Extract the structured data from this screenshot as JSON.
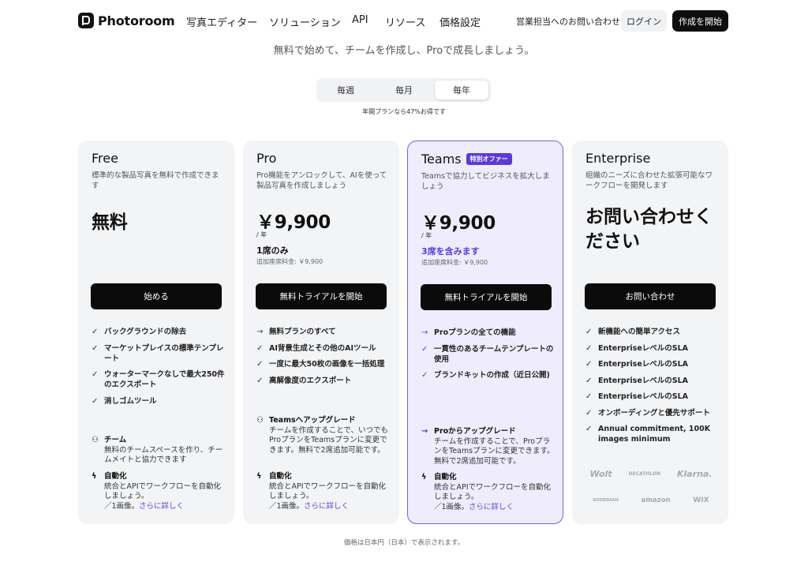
{
  "header": {
    "logo_text": "Photoroom",
    "nav": [
      "写真エディター",
      "ソリューション",
      "API",
      "リソース",
      "価格設定"
    ],
    "contact_sales": "営業担当へのお問い合わせ",
    "login": "ログイン",
    "start": "作成を開始"
  },
  "subtitle": "無料で始めて、チームを作成し、Proで成長しましょう。",
  "billing": {
    "options": [
      "毎週",
      "毎月",
      "毎年"
    ],
    "selected": "毎年",
    "note": "年間プランなら47%お得です"
  },
  "plans": [
    {
      "name": "Free",
      "desc": "標準的な製品写真を無料で作成できます",
      "price": "無料",
      "cta": "始める",
      "features": [
        "バックグラウンドの除去",
        "マーケットプレイスの標準テンプレート",
        "ウォーターマークなしで最大250件のエクスポート",
        "消しゴムツール"
      ],
      "team": {
        "title": "チーム",
        "body": "無料のチームスペースを作り、チームメイトと協力できます"
      },
      "automation": {
        "title": "自動化",
        "body": "統合とAPIでワークフローを自動化しましょう。",
        "suffix": "／1画像。",
        "link": "さらに詳しく"
      }
    },
    {
      "name": "Pro",
      "desc": "Pro機能をアンロックして、AIを使って製品写真を作成しましょう",
      "price": "￥9,900",
      "per": "/ 年",
      "seats": "1席のみ",
      "extra": "追加座席料金: ￥9,900",
      "cta": "無料トライアルを開始",
      "features": [
        "無料プランのすべて",
        "AI背景生成とその他のAIツール",
        "一度に最大50枚の画像を一括処理",
        "高解像度のエクスポート"
      ],
      "upgrade": {
        "title": "Teamsへアップグレード",
        "body": "チームを作成することで、いつでもProプランをTeamsプランに変更できます。無料で2席追加可能です。"
      },
      "automation": {
        "title": "自動化",
        "body": "統合とAPIでワークフローを自動化しましょう。",
        "suffix": "／1画像。",
        "link": "さらに詳しく"
      }
    },
    {
      "name": "Teams",
      "badge": "特別オファー",
      "desc": "Teamsで協力してビジネスを拡大しましょう",
      "price": "￥9,900",
      "per": "/ 年",
      "seats": "3席を含みます",
      "extra": "追加座席料金: ￥9,900",
      "cta": "無料トライアルを開始",
      "features": [
        "Proプランの全ての機能",
        "一貫性のあるチームテンプレートの使用",
        "ブランドキットの作成（近日公開)"
      ],
      "upgrade": {
        "title": "Proからアップグレード",
        "body": "チームを作成することで、ProプランをTeamsプランに変更できます。無料で2席追加可能です。"
      },
      "automation": {
        "title": "自動化",
        "body": "統合とAPIでワークフローを自動化しましょう。",
        "suffix": "／1画像。",
        "link": "さらに詳しく"
      }
    },
    {
      "name": "Enterprise",
      "desc": "組織のニーズに合わせた拡張可能なワークフローを開発します",
      "price": "お問い合わせください",
      "cta": "お問い合わせ",
      "features": [
        "新機能への簡単アクセス",
        "EnterpriseレベルのSLA",
        "EnterpriseレベルのSLA",
        "EnterpriseレベルのSLA",
        "EnterpriseレベルのSLA",
        "オンボーディングと優先サポート",
        "Annual commitment, 100K images minimum"
      ],
      "logos_row1": [
        "Wolt",
        "DECATHLON",
        "Klarna."
      ],
      "logos_row2": [
        "DOORDASH",
        "amazon",
        "WIX"
      ]
    }
  ],
  "footer_note": "価格は日本円（日本）で表示されます。",
  "colors": {
    "accent": "#5b3bd6",
    "teams_bg": "#efedfd",
    "card_bg": "#f3f4f6"
  }
}
